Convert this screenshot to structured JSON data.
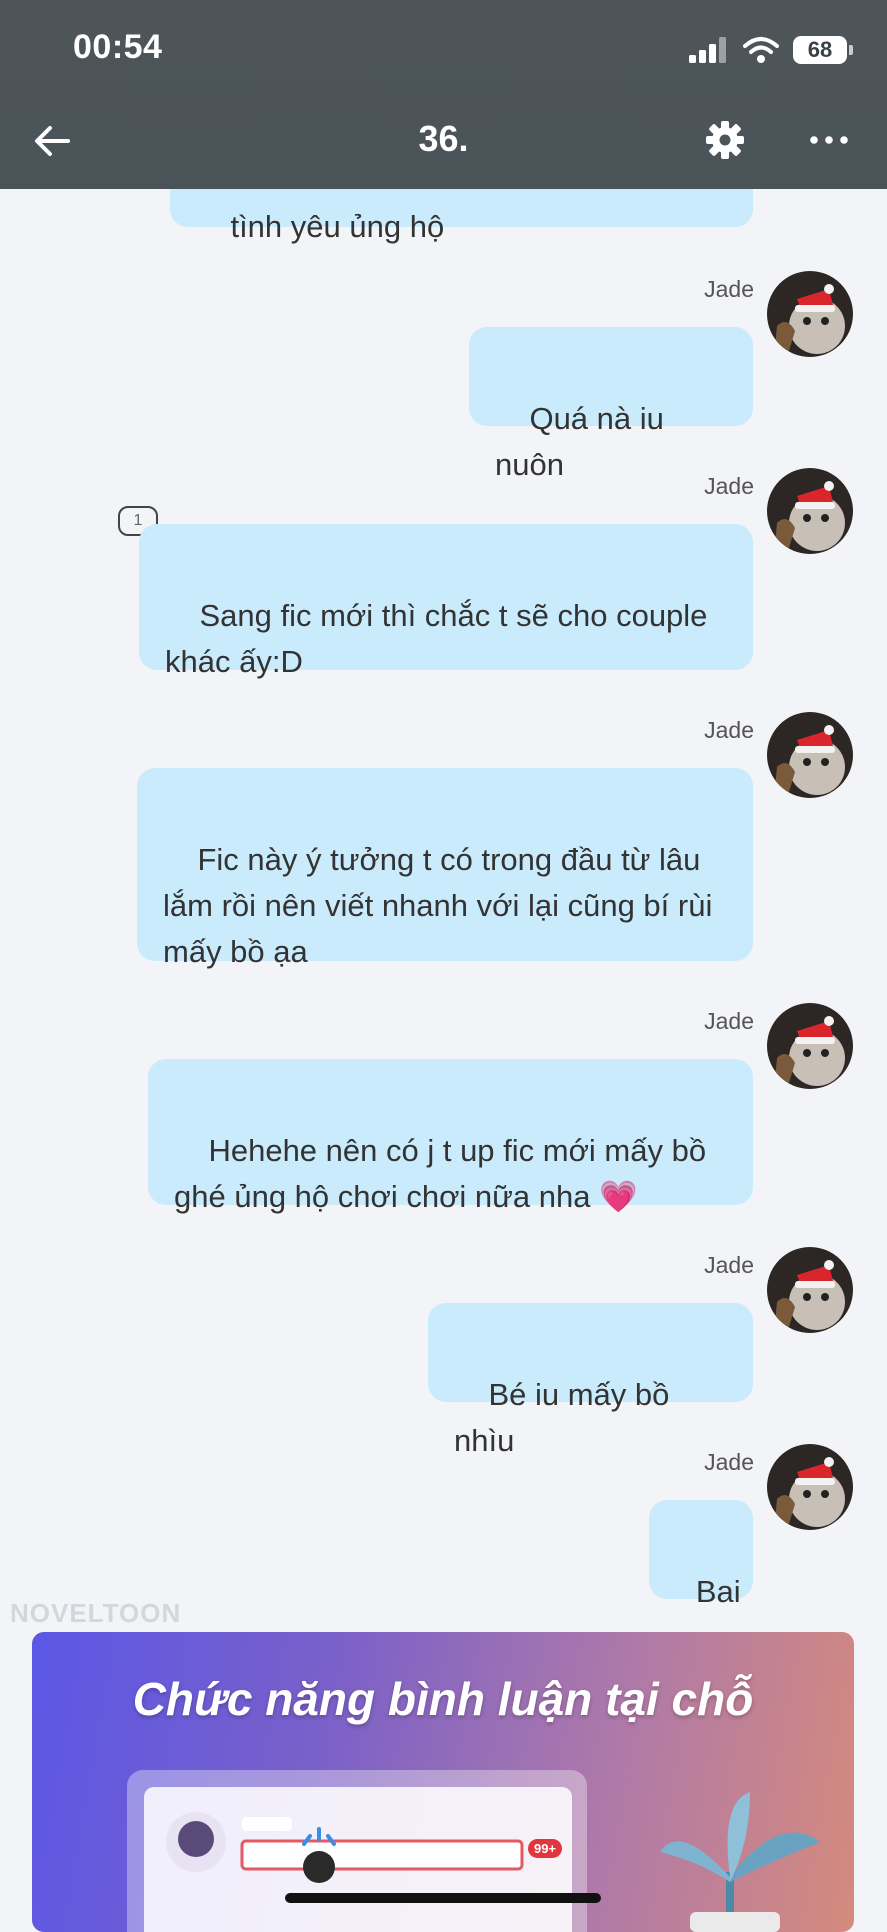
{
  "status_bar": {
    "time": "00:54",
    "battery": "68"
  },
  "nav": {
    "title": "36."
  },
  "messages": [
    {
      "text": "tình yêu ủng hộ",
      "sender": ""
    },
    {
      "text": "Quá nà iu nuôn",
      "sender": "Jade"
    },
    {
      "text": "Sang fic mới thì chắc t sẽ cho couple khác ấy:D",
      "sender": "Jade",
      "comment_badge": "1"
    },
    {
      "text": "Fic này ý tưởng t có trong đầu từ lâu lắm rồi nên viết nhanh với lại cũng bí rùi mấy bồ ạa",
      "sender": "Jade"
    },
    {
      "text": "Hehehe nên có j t up fic mới mấy bồ ghé ủng hộ chơi chơi nữa nha 💗",
      "sender": "Jade"
    },
    {
      "text": "Bé iu mấy bồ nhìu",
      "sender": "Jade"
    },
    {
      "text": "Bai",
      "sender": "Jade"
    }
  ],
  "watermark": "NOVELTOON",
  "banner": {
    "title": "Chức năng bình luận tại chỗ",
    "count_badge": "99+"
  },
  "colors": {
    "bubble": "#c9ebfb",
    "topbar": "#4e5558",
    "background": "#f3f4f8"
  }
}
